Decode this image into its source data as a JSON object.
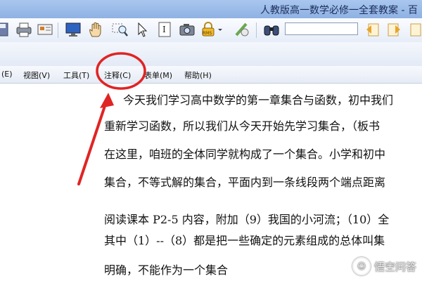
{
  "window": {
    "title": "人教版高一数学必修一全套教案 - 百"
  },
  "toolbar": {
    "icons": [
      "save-icon",
      "print-icon",
      "scan-icon",
      "monitor-icon",
      "hand-icon",
      "zoom-select-icon",
      "pointer-icon",
      "text-select-icon",
      "snapshot-icon",
      "rms-lock-icon",
      "sign-icon",
      "binoculars-icon",
      "prev-result-icon",
      "next-result-icon"
    ],
    "rms_label": "RMS",
    "search_value": ""
  },
  "menu": {
    "items": [
      {
        "label": "(E)"
      },
      {
        "label": "视图(V)"
      },
      {
        "label": "工具(T)"
      },
      {
        "label": "注释(C)"
      },
      {
        "label": "表单(M)"
      },
      {
        "label": "帮助(H)"
      }
    ]
  },
  "document": {
    "lines": [
      "今天我们学习高中数学的第一章集合与函数，初中我们",
      "重新学习函数，所以我们从今天开始先学习集合，（板书",
      "在这里，咱班的全体同学就构成了一个集合。小学和初中",
      "集合，不等式解的集合，平面内到一条线段两个端点距离",
      "阅读课本 P2-5 内容，附加（9）我国的小河流；（10）全",
      "其中（1）--（8）都是把一些确定的元素组成的总体叫集",
      "明确，不能作为一个集合"
    ]
  },
  "annotation": {
    "color": "#e02424"
  },
  "watermark": {
    "text": "悟空问答"
  }
}
